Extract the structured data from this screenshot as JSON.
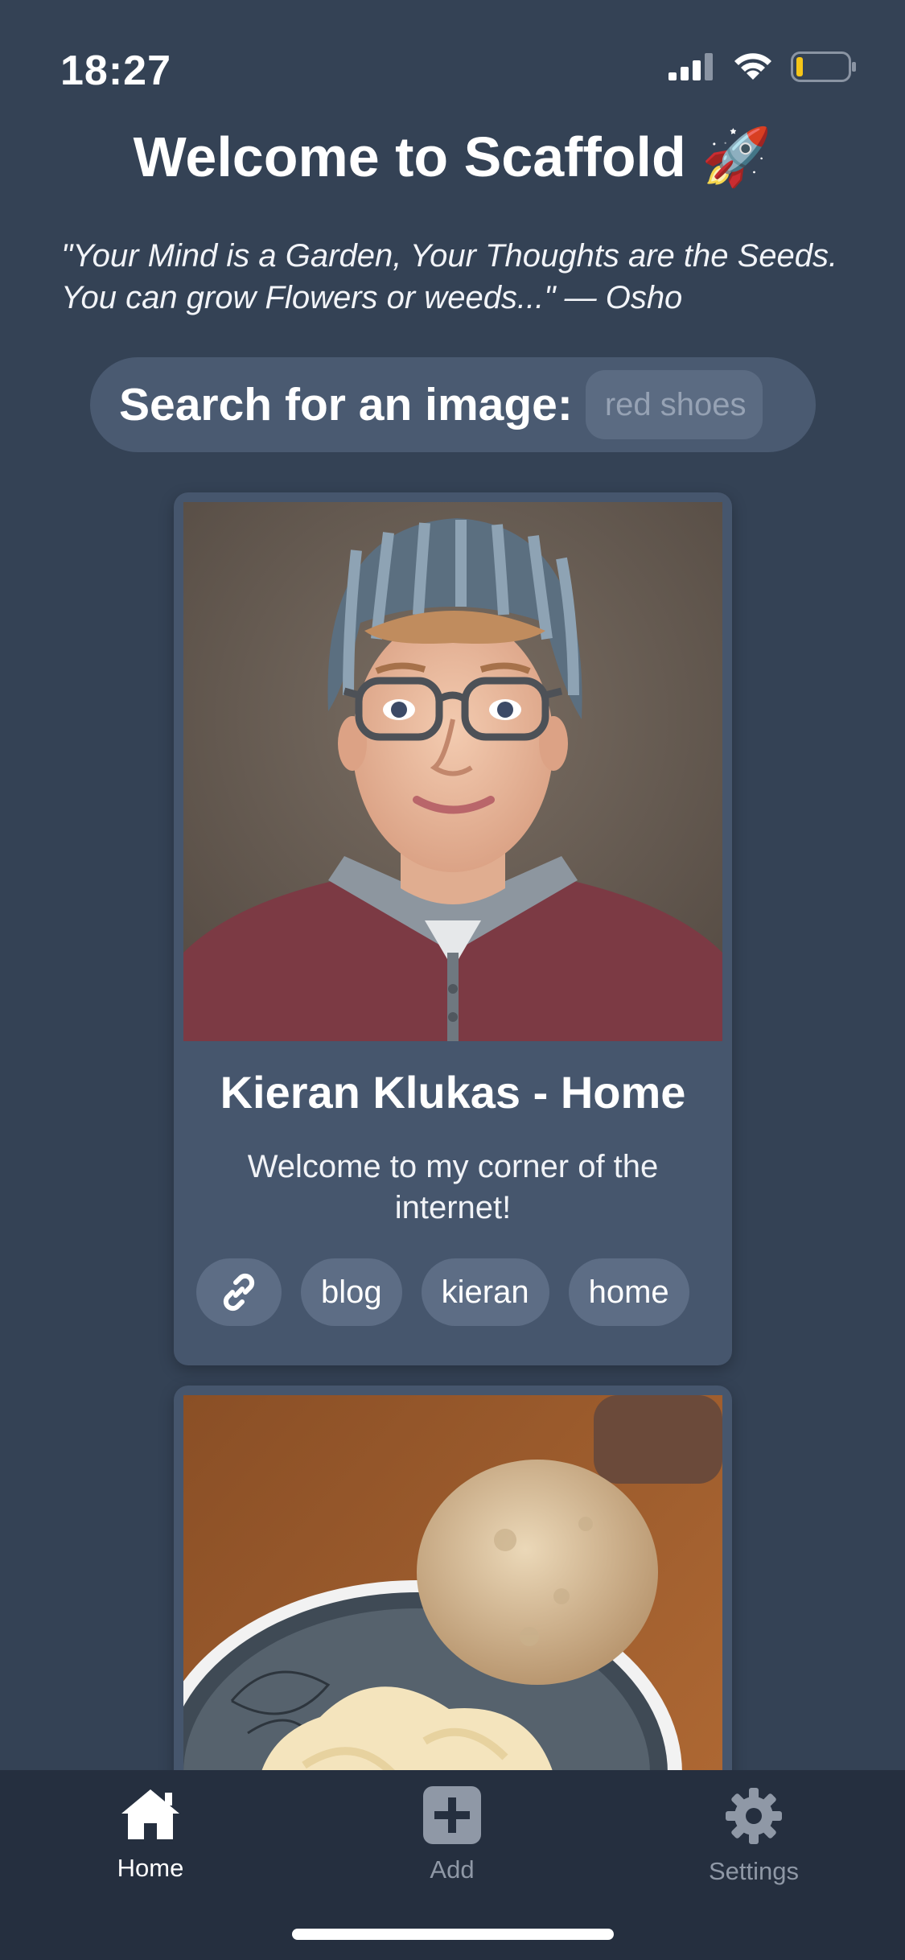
{
  "status_bar": {
    "time": "18:27",
    "icons": [
      "cellular-signal-icon",
      "wifi-icon",
      "battery-low-icon"
    ]
  },
  "header": {
    "title": "Welcome to Scaffold 🚀",
    "quote": "\"Your Mind is a Garden, Your Thoughts are the Seeds. You can grow Flowers or weeds...\" — Osho"
  },
  "search": {
    "label": "Search for an image:",
    "value": "",
    "placeholder": "red shoes"
  },
  "cards": [
    {
      "image_icon": "profile-illustration-image",
      "title": "Kieran Klukas - Home",
      "description": "Welcome to my corner of the internet!",
      "tags": [
        "blog",
        "kieran",
        "home"
      ],
      "link_icon": "link-icon"
    },
    {
      "image_icon": "cookie-and-ice-cream-photo"
    }
  ],
  "tab_bar": {
    "items": [
      {
        "label": "Home",
        "icon": "home-icon",
        "active": true
      },
      {
        "label": "Add",
        "icon": "plus-square-icon",
        "active": false
      },
      {
        "label": "Settings",
        "icon": "gear-icon",
        "active": false
      }
    ]
  },
  "colors": {
    "background": "#344255",
    "card": "#46566d",
    "tag": "#5d6d85",
    "tab_bar": "#252f3f",
    "inactive_tab": "#8f98a6",
    "battery_low": "#f5c518"
  }
}
